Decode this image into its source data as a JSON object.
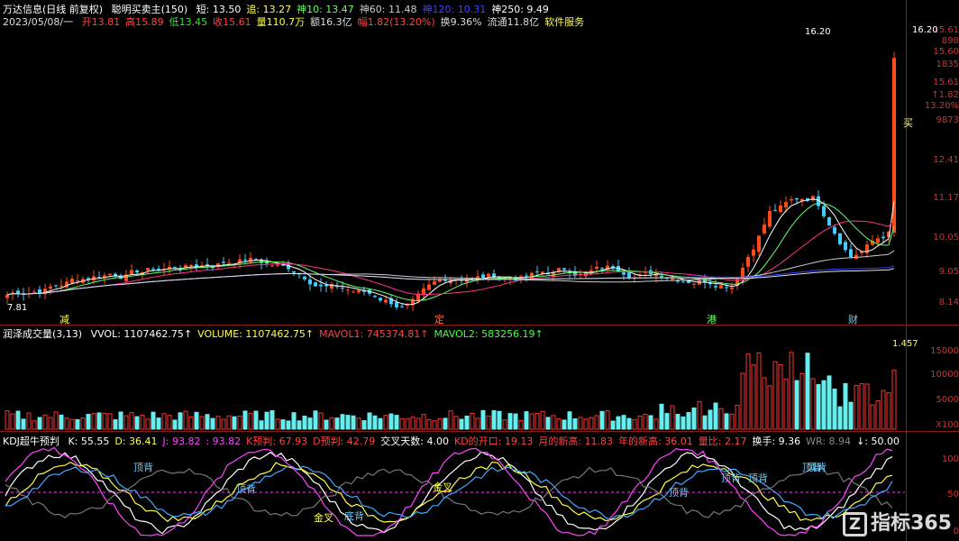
{
  "header": {
    "stock": "万达信息(日线 前复权)",
    "indicator": "聪明买卖主(150)",
    "ma": [
      {
        "label": "短: 13.50",
        "color": "#ffffff"
      },
      {
        "label": "追: 13.27",
        "color": "#ffff66"
      },
      {
        "label": "神10: 13.47",
        "color": "#66ff66"
      },
      {
        "label": "神60: 11.48",
        "color": "#cccccc"
      },
      {
        "label": "神120: 10.31",
        "color": "#4444ff"
      },
      {
        "label": "神250: 9.49",
        "color": "#ffffff"
      }
    ],
    "date": "2023/05/08/一",
    "quote": [
      {
        "label": "开13.81",
        "color": "#ff4444"
      },
      {
        "label": "高15.89",
        "color": "#ff4444"
      },
      {
        "label": "低13.45",
        "color": "#44dd44"
      },
      {
        "label": "收15.61",
        "color": "#ff4444"
      },
      {
        "label": "量110.7万",
        "color": "#ffff44"
      },
      {
        "label": "额16.3亿",
        "color": "#dddddd"
      },
      {
        "label": "幅1.82(13.20%)",
        "color": "#ff4444"
      },
      {
        "label": "换9.36%",
        "color": "#dddddd"
      },
      {
        "label": "流通11.8亿",
        "color": "#dddddd"
      },
      {
        "label": "软件服务",
        "color": "#ffff44"
      }
    ]
  },
  "price_axis": [
    "15.61",
    "898",
    "15.60",
    "1835",
    "15.61",
    "↑1.82",
    "13.20%",
    "9873",
    "12.41",
    "11.17",
    "10.05",
    "9.05",
    "8.14"
  ],
  "annotations": {
    "high": "16.20",
    "low": "7.81",
    "buy": "买"
  },
  "events": [
    {
      "label": "减",
      "color": "#ffff44"
    },
    {
      "label": "定",
      "color": "#ff6633"
    },
    {
      "label": "港",
      "color": "#66ff66"
    },
    {
      "label": "财",
      "color": "#66ccff"
    }
  ],
  "volume": {
    "title": "润泽成交量(3,13)",
    "items": [
      {
        "label": "VVOL: 1107462.75↑",
        "color": "#ffffff"
      },
      {
        "label": "VOLUME: 1107462.75↑",
        "color": "#ffff44"
      },
      {
        "label": "MAVOL1: 745374.81↑",
        "color": "#ff4444"
      },
      {
        "label": "MAVOL2: 583256.19↑",
        "color": "#44ff44"
      }
    ],
    "ratio": "1.457",
    "axis": [
      "15000",
      "10000",
      "5000",
      "X100"
    ]
  },
  "kdj": {
    "title": "KDJ超牛预判",
    "items": [
      {
        "label": "K: 55.55",
        "color": "#ffffff"
      },
      {
        "label": "D: 36.41",
        "color": "#ffff44"
      },
      {
        "label": "J: 93.82",
        "color": "#ff44ff"
      },
      {
        "label": ": 93.82",
        "color": "#ff44ff"
      },
      {
        "label": "K预判: 67.93",
        "color": "#ff4444"
      },
      {
        "label": "D预判: 42.79",
        "color": "#ff4444"
      },
      {
        "label": "交叉天数: 4.00",
        "color": "#ffffff"
      },
      {
        "label": "KD的开口: 19.13",
        "color": "#ff4444"
      },
      {
        "label": "月的新高: 11.83",
        "color": "#ff4444"
      },
      {
        "label": "年的新高: 36.01",
        "color": "#ff4444"
      },
      {
        "label": "量比: 2.17",
        "color": "#ff4444"
      },
      {
        "label": "换手: 9.36",
        "color": "#ffffff"
      },
      {
        "label": "WR: 8.94",
        "color": "#888888"
      },
      {
        "label": "↓: 50.00",
        "color": "#ffffff"
      }
    ],
    "axis": [
      "100",
      "50",
      "0"
    ],
    "tags": [
      "顶背",
      "顶背",
      "顶背",
      "金叉",
      "底背",
      "金叉",
      "顶背",
      "顶背",
      "顶背",
      "顶背"
    ]
  },
  "watermark": "指标365"
}
